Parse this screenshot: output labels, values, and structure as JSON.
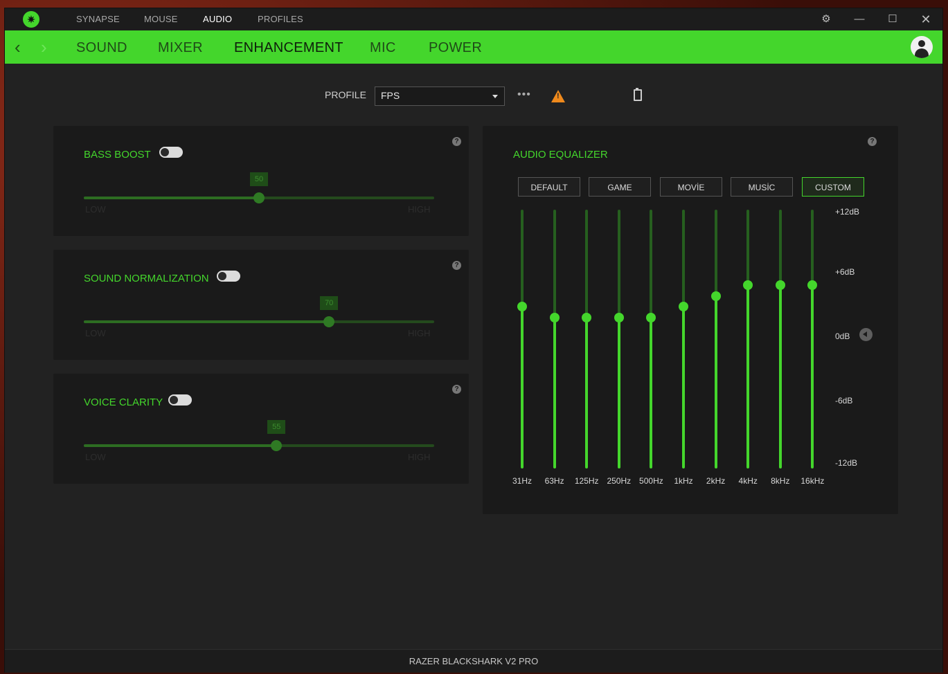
{
  "titlebar": {
    "nav": [
      "SYNAPSE",
      "MOUSE",
      "AUDIO",
      "PROFILES"
    ],
    "active_nav": "AUDIO",
    "controls": [
      "settings-icon",
      "minimize-icon",
      "maximize-icon",
      "close-icon"
    ]
  },
  "subnav": {
    "items": [
      "SOUND",
      "MIXER",
      "ENHANCEMENT",
      "MIC",
      "POWER"
    ],
    "active": "ENHANCEMENT"
  },
  "profile": {
    "label": "PROFILE",
    "value": "FPS",
    "more": "•••"
  },
  "enhancements": [
    {
      "title": "BASS BOOST",
      "value": "50",
      "low": "LOW",
      "high": "HIGH",
      "enabled": false
    },
    {
      "title": "SOUND NORMALIZATION",
      "value": "70",
      "low": "LOW",
      "high": "HIGH",
      "enabled": false
    },
    {
      "title": "VOICE CLARITY",
      "value": "55",
      "low": "LOW",
      "high": "HIGH",
      "enabled": false
    }
  ],
  "equalizer": {
    "title": "AUDIO EQUALIZER",
    "presets": [
      "DEFAULT",
      "GAME",
      "MOVİE",
      "MUSİC",
      "CUSTOM"
    ],
    "active_preset": "CUSTOM",
    "db_labels": [
      "+12dB",
      "+6dB",
      "0dB",
      "-6dB",
      "-12dB"
    ],
    "bands": [
      {
        "freq": "31Hz",
        "gain": 3
      },
      {
        "freq": "63Hz",
        "gain": 2
      },
      {
        "freq": "125Hz",
        "gain": 2
      },
      {
        "freq": "250Hz",
        "gain": 2
      },
      {
        "freq": "500Hz",
        "gain": 2
      },
      {
        "freq": "1kHz",
        "gain": 3
      },
      {
        "freq": "2kHz",
        "gain": 4
      },
      {
        "freq": "4kHz",
        "gain": 5
      },
      {
        "freq": "8kHz",
        "gain": 5
      },
      {
        "freq": "16kHz",
        "gain": 5
      }
    ]
  },
  "footer": {
    "device": "RAZER BLACKSHARK V2 PRO"
  },
  "colors": {
    "accent": "#44d62c",
    "background": "#222222",
    "card": "#1a1a1a",
    "warning": "#f08a1c"
  }
}
